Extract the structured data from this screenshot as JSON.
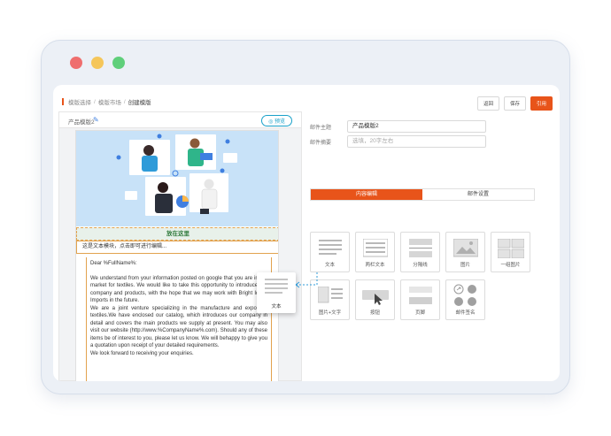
{
  "breadcrumb": [
    "模版选择",
    "模版市场",
    "创建模版"
  ],
  "toolbar": {
    "back": "返回",
    "save": "保存",
    "apply": "引用"
  },
  "editor": {
    "template_name": "产品模版2",
    "preview": "预览"
  },
  "canvas": {
    "drop_text": "放在这里",
    "text_module": "这是文本模块，点击即可进行编辑...",
    "greeting": "Dear %FullName%:",
    "paragraphs": [
      "We understand from your information posted on google that you are in the market for textiles. We would like to take this opportunity to introduce our company and products, with the hope that we may work with Bright Ideas Imports in the future.",
      "We are a joint venture specializing in the manufacture and export of textiles.We have enclosed our catalog, which introduces our company in detail and covers the main products we supply at present. You may also visit our website (http://www.%CompanyName%.com). Should any of these items be of interest to you, please let us know. We will behappy to give you a quotation upon receipt of your detailed requirements.",
      "We look forward to receiving your enquiries."
    ]
  },
  "form": {
    "subject_label": "邮件主题",
    "subject_value": "产品模版2",
    "summary_label": "邮件摘要",
    "summary_placeholder": "选填，20字左右"
  },
  "tabs": {
    "content": "内容编辑",
    "settings": "邮件设置"
  },
  "components": [
    {
      "label": "文本",
      "icon": "text-lines-icon"
    },
    {
      "label": "两栏文本",
      "icon": "two-column-text-icon"
    },
    {
      "label": "分隔线",
      "icon": "divider-icon"
    },
    {
      "label": "图片",
      "icon": "image-icon"
    },
    {
      "label": "一组图片",
      "icon": "image-group-icon"
    },
    {
      "label": "图片+文字",
      "icon": "image-text-icon"
    },
    {
      "label": "按钮",
      "icon": "button-icon"
    },
    {
      "label": "页脚",
      "icon": "footer-icon"
    },
    {
      "label": "邮件签名",
      "icon": "social-signature-icon"
    }
  ],
  "drag_card": {
    "label": "文本"
  },
  "colors": {
    "accent": "#e8541a",
    "hero_bg": "#c8e2f8",
    "preview": "#1aa1c9"
  }
}
